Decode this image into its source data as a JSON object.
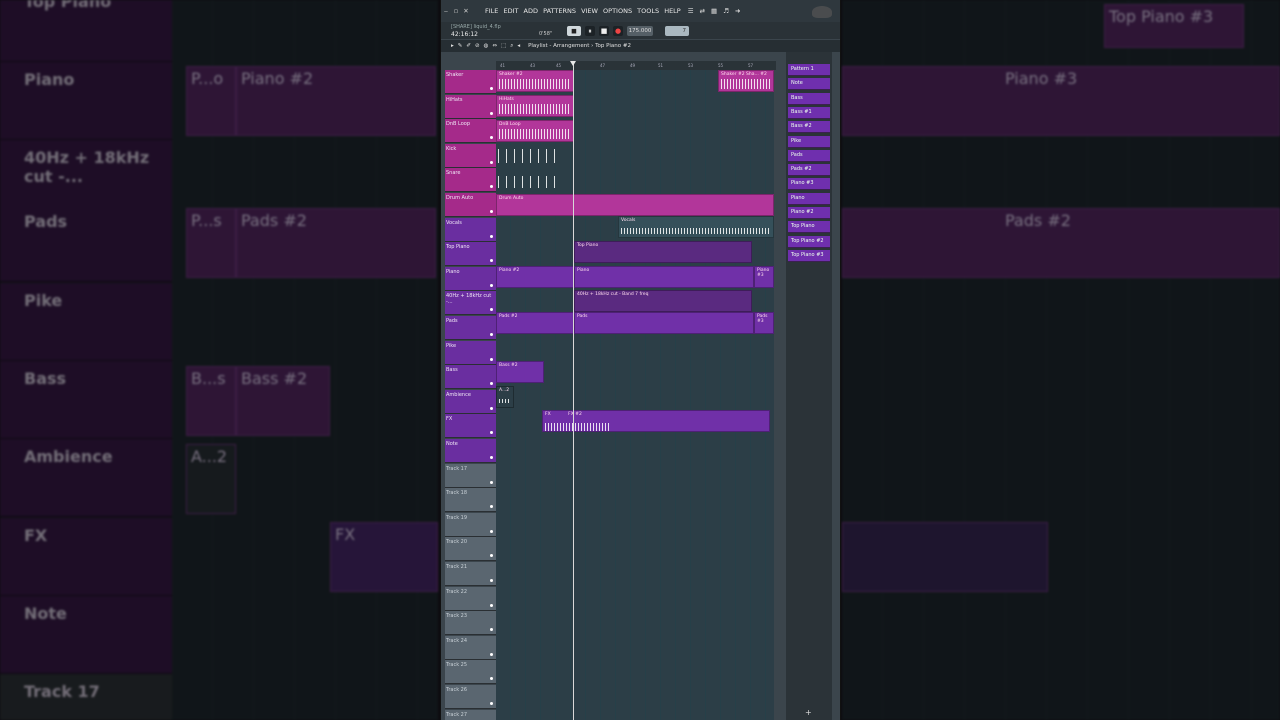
{
  "background_left": {
    "tracks": [
      "Top Piano",
      "Piano",
      "40Hz + 18kHz cut -...",
      "Pads",
      "Pike",
      "Bass",
      "Ambience",
      "FX",
      "Note",
      "Track 17"
    ],
    "clips": [
      "P...o",
      "Piano #2",
      "P...s",
      "Pads #2",
      "B...s",
      "Bass #2",
      "A...2",
      "FX"
    ]
  },
  "background_right": {
    "clips": [
      "Top Piano #3",
      "Piano #3",
      "Pads #2"
    ]
  },
  "menubar": {
    "menus": [
      "FILE",
      "EDIT",
      "ADD",
      "PATTERNS",
      "VIEW",
      "OPTIONS",
      "TOOLS",
      "HELP"
    ]
  },
  "transport": {
    "project": "[SHARE] liquid_4.flp",
    "time": "42:16:12",
    "ms": "0'58\"",
    "tempo": "175.000",
    "pattern": "7"
  },
  "playlist": {
    "title": "Playlist - Arrangement › Top Piano #2",
    "ruler": [
      "41",
      "43",
      "45",
      "47",
      "49",
      "51",
      "53",
      "55",
      "57"
    ]
  },
  "tracks": [
    {
      "name": "Shaker",
      "color": "pink"
    },
    {
      "name": "HiHats",
      "color": "pink"
    },
    {
      "name": "DnB Loop",
      "color": "pink"
    },
    {
      "name": "Kick",
      "color": "pink"
    },
    {
      "name": "Snare",
      "color": "pink"
    },
    {
      "name": "Drum Auto",
      "color": "pink"
    },
    {
      "name": "Vocals",
      "color": "purple"
    },
    {
      "name": "Top Piano",
      "color": "purple"
    },
    {
      "name": "Piano",
      "color": "purple"
    },
    {
      "name": "40Hz + 18kHz cut -...",
      "color": "purple"
    },
    {
      "name": "Pads",
      "color": "purple"
    },
    {
      "name": "Pike",
      "color": "purple"
    },
    {
      "name": "Bass",
      "color": "purple"
    },
    {
      "name": "Ambience",
      "color": "purple"
    },
    {
      "name": "FX",
      "color": "purple"
    },
    {
      "name": "Note",
      "color": "purple"
    },
    {
      "name": "Track 17",
      "color": "grey"
    },
    {
      "name": "Track 18",
      "color": "grey"
    },
    {
      "name": "Track 19",
      "color": "grey"
    },
    {
      "name": "Track 20",
      "color": "grey"
    },
    {
      "name": "Track 21",
      "color": "grey"
    },
    {
      "name": "Track 22",
      "color": "grey"
    },
    {
      "name": "Track 23",
      "color": "grey"
    },
    {
      "name": "Track 24",
      "color": "grey"
    },
    {
      "name": "Track 25",
      "color": "grey"
    },
    {
      "name": "Track 26",
      "color": "grey"
    },
    {
      "name": "Track 27",
      "color": "grey"
    }
  ],
  "clips": {
    "shaker": "Shaker #2",
    "shaker_right": "Shaker #2",
    "shaker_right2": "Sha... #2",
    "hihats": "HiHats",
    "dnb": "DnB Loop",
    "drum_auto": "Drum Auto",
    "vocals": "Vocals",
    "top_piano": "Top Piano",
    "piano_a": "Piano #2",
    "piano_b": "Piano",
    "piano_c": "Piano #3",
    "cut": "40Hz + 18kHz cut - Band 7 freq",
    "pads_a": "Pads #2",
    "pads_b": "Pads",
    "pads_c": "Pads #3",
    "bass": "Bass #2",
    "ambience": "A...2",
    "fx": "FX",
    "fx2": "FX #2"
  },
  "picker": [
    "Pattern 1",
    "Note",
    "Bass",
    "Bass #1",
    "Bass #2",
    "Pike",
    "Pads",
    "Pads #2",
    "Piano #3",
    "Piano",
    "Piano #2",
    "Top Piano",
    "Top Piano #2",
    "Top Piano #3"
  ]
}
